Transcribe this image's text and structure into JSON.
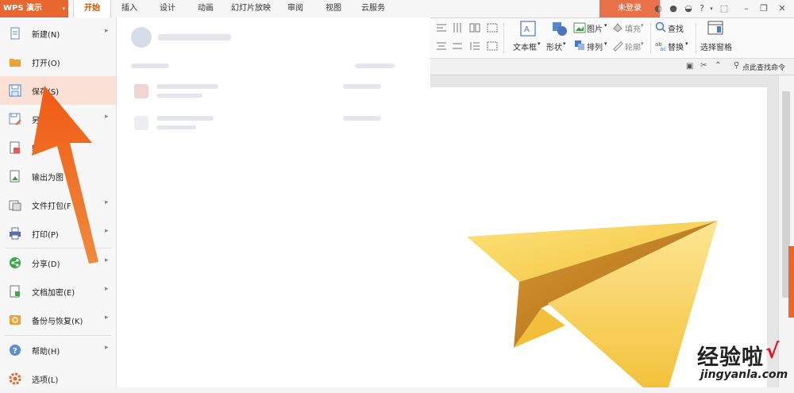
{
  "app": {
    "menu_label": "WPS 演示",
    "caret": "▾"
  },
  "tabs": [
    {
      "label": "开始",
      "active": true
    },
    {
      "label": "插入"
    },
    {
      "label": "设计"
    },
    {
      "label": "动画"
    },
    {
      "label": "幻灯片放映"
    },
    {
      "label": "审阅"
    },
    {
      "label": "视图"
    },
    {
      "label": "云服务"
    }
  ],
  "login_label": "未登录",
  "ribbon": {
    "textbox_label": "文本框",
    "shape_label": "形状",
    "picture_label": "图片",
    "arrange_label": "排列",
    "fill_label": "填充",
    "outline_label": "轮廓",
    "find_label": "查找",
    "replace_label": "替换",
    "select_pane_label": "选择窗格"
  },
  "find_command": "点此查找命令",
  "file_menu": [
    {
      "label": "新建(N)",
      "icon": "new-icon",
      "arrow": true
    },
    {
      "label": "打开(O)",
      "icon": "open-folder-icon",
      "arrow": false
    },
    {
      "label": "保存(S)",
      "icon": "save-icon",
      "arrow": false,
      "selected": true
    },
    {
      "label": "另存",
      "icon": "save-as-icon",
      "arrow": true
    },
    {
      "label": "输",
      "icon": "export-icon",
      "arrow": false
    },
    {
      "label": "输出为图",
      "icon": "export-image-icon",
      "arrow": false
    },
    {
      "label": "文件打包(F",
      "icon": "package-icon",
      "arrow": true
    },
    {
      "label": "打印(P)",
      "icon": "print-icon",
      "arrow": true
    },
    {
      "label": "分享(D)",
      "icon": "share-icon",
      "arrow": true
    },
    {
      "label": "文档加密(E)",
      "icon": "encrypt-icon",
      "arrow": true
    },
    {
      "label": "备份与恢复(K)",
      "icon": "backup-icon",
      "arrow": true
    },
    {
      "label": "帮助(H)",
      "icon": "help-icon",
      "arrow": true
    },
    {
      "label": "选项(L)",
      "icon": "options-icon",
      "arrow": false
    }
  ],
  "watermark": {
    "line1": "经验啦",
    "line2": "jingyanla.com",
    "check": "√"
  },
  "colors": {
    "accent": "#e8672e",
    "selected_bg": "#fbe0d6",
    "arrow": "#f26b1d",
    "plane": "#f6c83a"
  }
}
